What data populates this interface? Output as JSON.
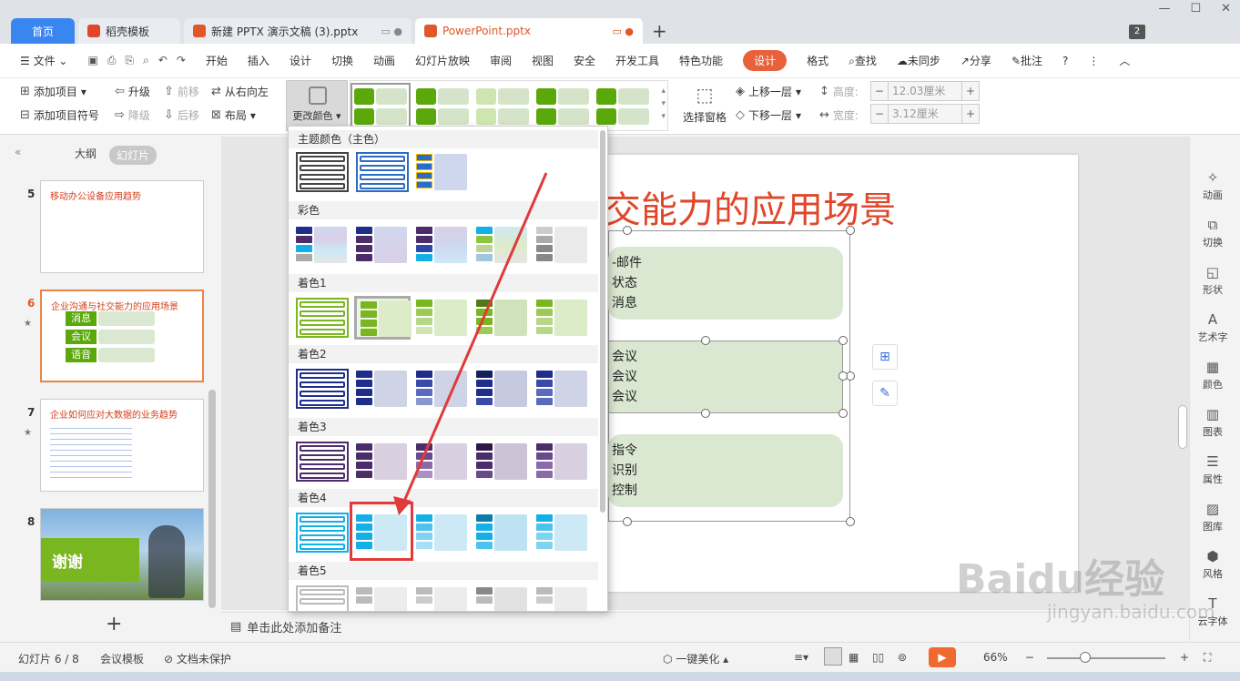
{
  "tabs": [
    {
      "label": "首页"
    },
    {
      "label": "稻壳模板"
    },
    {
      "label": "新建 PPTX 演示文稿 (3).pptx"
    },
    {
      "label": "PowerPoint.pptx"
    }
  ],
  "window_badge": "2",
  "menu": {
    "file": "文件",
    "items": [
      "开始",
      "插入",
      "设计",
      "切换",
      "动画",
      "幻灯片放映",
      "审阅",
      "视图",
      "安全",
      "开发工具",
      "特色功能",
      "设计",
      "格式"
    ],
    "search": "查找",
    "sync": "未同步",
    "share": "分享",
    "comment": "批注"
  },
  "ribbon": {
    "add_item": "添加项目",
    "add_item_bullet": "添加项目符号",
    "promote": "升级",
    "demote": "降级",
    "move_forward": "前移",
    "move_back": "后移",
    "right_to_left": "从右向左",
    "layout": "布局",
    "change_color": "更改颜色",
    "selection_pane": "选择窗格",
    "bring_forward": "上移一层",
    "send_backward": "下移一层",
    "height_label": "高度:",
    "height_value": "12.03厘米",
    "width_label": "宽度:",
    "width_value": "3.12厘米"
  },
  "left_panel": {
    "tab_outline": "大纲",
    "tab_slides": "幻灯片",
    "slides": [
      {
        "num": "5",
        "title": "移动办公设备应用趋势"
      },
      {
        "num": "6",
        "title": "企业沟通与社交能力的应用场景",
        "items": [
          "消息",
          "会议",
          "语音"
        ]
      },
      {
        "num": "7",
        "title": "企业如何应对大数据的业务趋势"
      },
      {
        "num": "8",
        "title": "谢谢"
      }
    ]
  },
  "slide": {
    "title": "交能力的应用场景",
    "box1": [
      "-邮件",
      "状态",
      "消息"
    ],
    "box2": [
      "会议",
      "会议",
      "会议"
    ],
    "box3": [
      "指令",
      "识别",
      "控制"
    ]
  },
  "notes_placeholder": "单击此处添加备注",
  "right_sidebar": [
    "动画",
    "切换",
    "形状",
    "艺术字",
    "颜色",
    "图表",
    "属性",
    "图库",
    "风格",
    "云字体"
  ],
  "status": {
    "slide_info": "幻灯片 6 / 8",
    "template": "会议模板",
    "protect": "文档未保护",
    "beautify": "一键美化",
    "zoom": "66%"
  },
  "dropdown": {
    "sections": [
      "主题颜色（主色）",
      "彩色",
      "着色1",
      "着色2",
      "着色3",
      "着色4",
      "着色5"
    ]
  },
  "colors": {
    "accent_orange": "#e8613b",
    "green": "#5aa80a",
    "blue": "#2b6cc4",
    "navy": "#1e2e8a",
    "purple": "#4a2d6a",
    "cyan": "#12b0e6",
    "highlight_red": "#e03a3a"
  },
  "watermark": {
    "brand": "Baidu经验",
    "url": "jingyan.baidu.com"
  }
}
